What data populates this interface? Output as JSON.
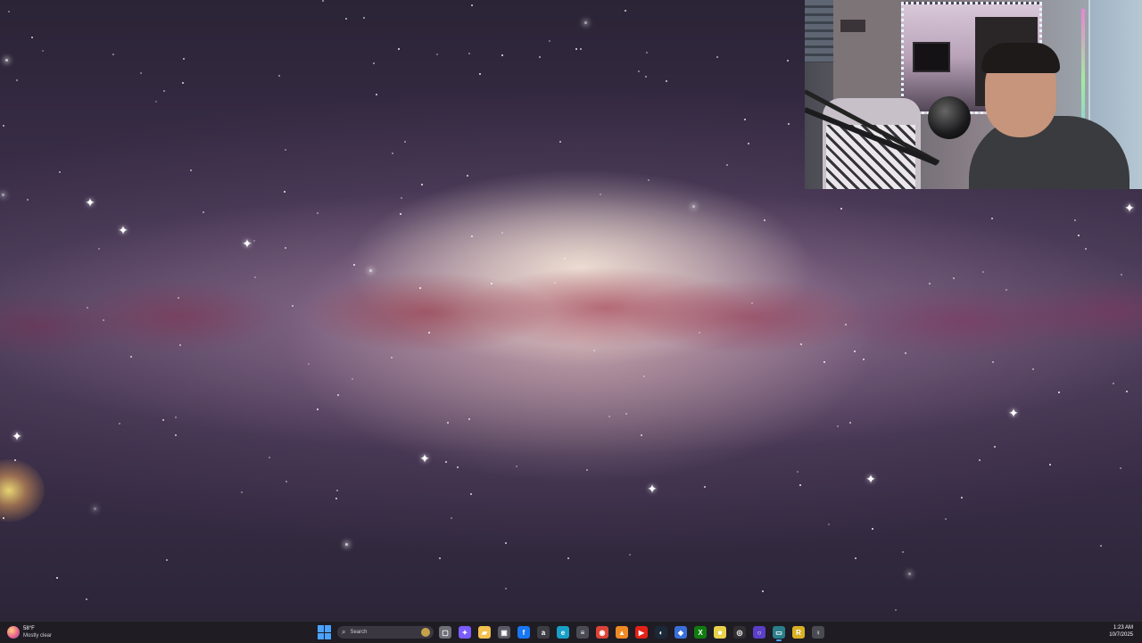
{
  "taskbar": {
    "weather": {
      "temp": "58°F",
      "condition": "Mostly clear",
      "icon": "weather-night-icon"
    },
    "search": {
      "label": "Search"
    },
    "apps": [
      {
        "name": "task-view",
        "icon": "task-view-icon",
        "glyph": "▢",
        "color": "#6f6f78"
      },
      {
        "name": "copilot",
        "icon": "copilot-icon",
        "glyph": "✦",
        "color": "#7a5cff"
      },
      {
        "name": "file-explorer",
        "icon": "folder-icon",
        "glyph": "▰",
        "color": "#f2c14e"
      },
      {
        "name": "store",
        "icon": "store-icon",
        "glyph": "▣",
        "color": "#5a5a66"
      },
      {
        "name": "facebook",
        "icon": "facebook-icon",
        "glyph": "f",
        "color": "#1877f2"
      },
      {
        "name": "amazon",
        "icon": "amazon-icon",
        "glyph": "a",
        "color": "#3d3d44"
      },
      {
        "name": "edge",
        "icon": "edge-icon",
        "glyph": "e",
        "color": "#1aa0c8"
      },
      {
        "name": "notepad",
        "icon": "notepad-icon",
        "glyph": "≡",
        "color": "#4b4b55"
      },
      {
        "name": "chrome",
        "icon": "chrome-icon",
        "glyph": "◉",
        "color": "#db4437"
      },
      {
        "name": "vlc",
        "icon": "vlc-icon",
        "glyph": "▲",
        "color": "#f08a24"
      },
      {
        "name": "youtube",
        "icon": "youtube-icon",
        "glyph": "▶",
        "color": "#e62117"
      },
      {
        "name": "steam",
        "icon": "steam-icon",
        "glyph": "◐",
        "color": "#1b2838"
      },
      {
        "name": "app-blue",
        "icon": "app-icon",
        "glyph": "◆",
        "color": "#3a6fd8"
      },
      {
        "name": "xbox",
        "icon": "xbox-icon",
        "glyph": "X",
        "color": "#107c10"
      },
      {
        "name": "sticky-notes",
        "icon": "sticky-notes-icon",
        "glyph": "■",
        "color": "#e8d24a"
      },
      {
        "name": "obs",
        "icon": "obs-icon",
        "glyph": "◎",
        "color": "#302e31"
      },
      {
        "name": "app-purple",
        "icon": "circle-app-icon",
        "glyph": "○",
        "color": "#5b3fc7"
      },
      {
        "name": "app-teal",
        "icon": "terminal-icon",
        "glyph": "▭",
        "color": "#2a7f8a",
        "active": true
      },
      {
        "name": "app-yellow",
        "icon": "game-icon",
        "glyph": "R",
        "color": "#d8b023"
      },
      {
        "name": "app-mic",
        "icon": "microphone-icon",
        "glyph": "♀",
        "color": "#4a4a52"
      }
    ],
    "clock": {
      "time": "1:23 AM",
      "date": "10/7/2025"
    }
  }
}
